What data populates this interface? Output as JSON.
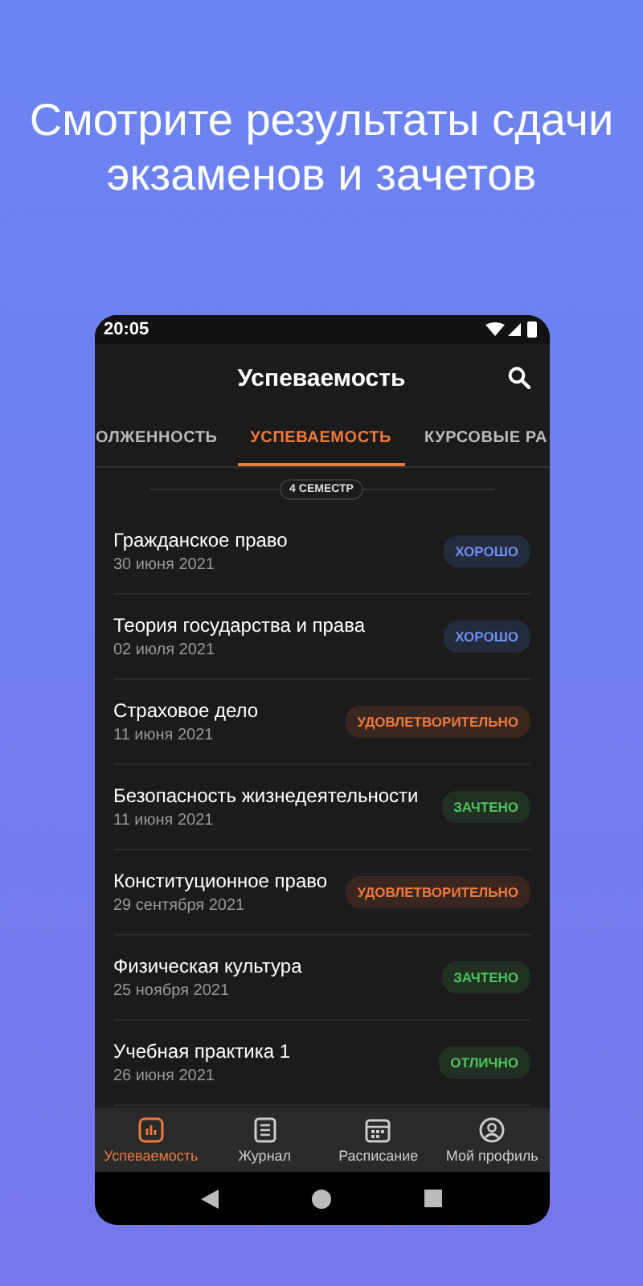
{
  "headline": "Смотрите результаты сдачи экзаменов и зачетов",
  "status_bar": {
    "time": "20:05"
  },
  "app_bar": {
    "title": "Успеваемость"
  },
  "tabs": [
    {
      "label": "ОЛЖЕННОСТЬ",
      "selected": false
    },
    {
      "label": "УСПЕВАЕМОСТЬ",
      "selected": true
    },
    {
      "label": "КУРСОВЫЕ РА",
      "selected": false
    }
  ],
  "semester": "4 СЕМЕСТР",
  "subjects": [
    {
      "name": "Гражданское право",
      "date": "30 июня 2021",
      "grade": "ХОРОШО",
      "kind": "good"
    },
    {
      "name": "Теория государства и права",
      "date": "02 июля 2021",
      "grade": "ХОРОШО",
      "kind": "good"
    },
    {
      "name": "Страховое дело",
      "date": "11 июня 2021",
      "grade": "УДОВЛЕТВОРИТЕЛЬНО",
      "kind": "satisfactory"
    },
    {
      "name": "Безопасность жизнедеятельности",
      "date": "11 июня 2021",
      "grade": "ЗАЧТЕНО",
      "kind": "pass"
    },
    {
      "name": "Конституционное право",
      "date": "29 сентября 2021",
      "grade": "УДОВЛЕТВОРИТЕЛЬНО",
      "kind": "satisfactory"
    },
    {
      "name": "Физическая культура",
      "date": "25 ноября 2021",
      "grade": "ЗАЧТЕНО",
      "kind": "pass"
    },
    {
      "name": "Учебная практика 1",
      "date": "26 июня 2021",
      "grade": "ОТЛИЧНО",
      "kind": "pass"
    }
  ],
  "bottom_nav": [
    {
      "label": "Успеваемость",
      "selected": true
    },
    {
      "label": "Журнал",
      "selected": false
    },
    {
      "label": "Расписание",
      "selected": false
    },
    {
      "label": "Мой профиль",
      "selected": false
    }
  ]
}
